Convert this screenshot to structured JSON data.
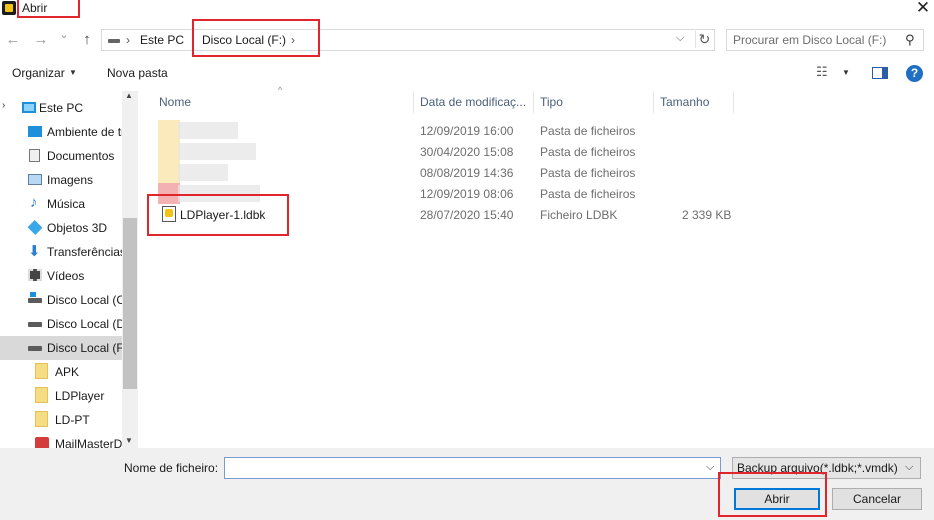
{
  "window": {
    "title": "Abrir",
    "close_glyph": "✕"
  },
  "address_bar": {
    "back_glyph": "←",
    "forward_glyph": "→",
    "recent_glyph": "⌄",
    "up_glyph": "↑",
    "crumbs": [
      "Este PC",
      "Disco Local (F:)"
    ],
    "separator": "›",
    "dropdown_glyph": "⌵",
    "refresh_glyph": "↻"
  },
  "search": {
    "placeholder": "Procurar em Disco Local (F:)",
    "icon_glyph": "⚲"
  },
  "toolbar": {
    "organize_label": "Organizar",
    "new_folder_label": "Nova pasta",
    "caret": "▼",
    "view_glyph": "☷",
    "help_glyph": "?"
  },
  "nav": {
    "expand_glyph": "›",
    "items": [
      {
        "label": "Este PC",
        "icon": "monitor-icon"
      },
      {
        "label": "Ambiente de trabalho",
        "icon": "desktop-icon"
      },
      {
        "label": "Documentos",
        "icon": "documents-icon"
      },
      {
        "label": "Imagens",
        "icon": "images-icon"
      },
      {
        "label": "Música",
        "icon": "music-icon"
      },
      {
        "label": "Objetos 3D",
        "icon": "objects-3d-icon"
      },
      {
        "label": "Transferências",
        "icon": "downloads-icon"
      },
      {
        "label": "Vídeos",
        "icon": "videos-icon"
      },
      {
        "label": "Disco Local (C:)",
        "icon": "system-drive-icon"
      },
      {
        "label": "Disco Local (D:)",
        "icon": "drive-icon"
      },
      {
        "label": "Disco Local (F:)",
        "icon": "drive-icon",
        "selected": true
      },
      {
        "label": "APK",
        "icon": "folder-icon"
      },
      {
        "label": "LDPlayer",
        "icon": "folder-icon"
      },
      {
        "label": "LD-PT",
        "icon": "folder-icon"
      },
      {
        "label": "MailMasterData",
        "icon": "mail-icon"
      }
    ],
    "scroll_up_glyph": "▲",
    "scroll_down_glyph": "▼"
  },
  "file_list": {
    "columns": {
      "name": "Nome",
      "date": "Data de modificaç...",
      "type": "Tipo",
      "size": "Tamanho"
    },
    "sort_glyph": "^",
    "rows": [
      {
        "name": "",
        "date": "12/09/2019 16:00",
        "type": "Pasta de ficheiros",
        "size": ""
      },
      {
        "name": "",
        "date": "30/04/2020 15:08",
        "type": "Pasta de ficheiros",
        "size": ""
      },
      {
        "name": "",
        "date": "08/08/2019 14:36",
        "type": "Pasta de ficheiros",
        "size": ""
      },
      {
        "name": "",
        "date": "12/09/2019 08:06",
        "type": "Pasta de ficheiros",
        "size": ""
      },
      {
        "name": "LDPlayer-1.ldbk",
        "date": "28/07/2020 15:40",
        "type": "Ficheiro LDBK",
        "size": "2 339 KB"
      }
    ],
    "blur_colors": [
      "#fbe8b4",
      "#fbe8b4",
      "#fbe8b4",
      "#f3a8a8"
    ]
  },
  "bottom": {
    "filename_label": "Nome de ficheiro:",
    "filename_value": "",
    "filename_dd": "⌵",
    "filetype_value": "Backup arquivo(*.ldbk;*.vmdk)",
    "filetype_dd": "⌵",
    "open_label": "Abrir",
    "cancel_label": "Cancelar"
  },
  "annotation_color": "#e0262c"
}
